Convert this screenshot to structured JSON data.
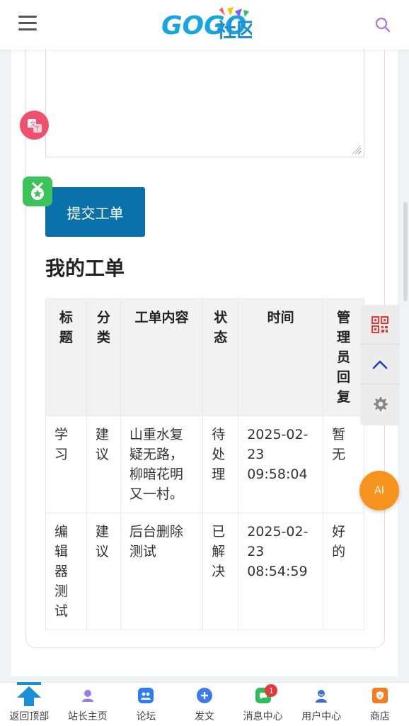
{
  "header": {
    "logo_text": "GOGO",
    "logo_sub": "社区"
  },
  "form": {
    "submit_label": "提交工单"
  },
  "section": {
    "title": "我的工单"
  },
  "table": {
    "headers": [
      "标题",
      "分类",
      "工单内容",
      "状态",
      "时间",
      "管理员回复"
    ],
    "rows": [
      {
        "title": "学习",
        "category": "建议",
        "content": "山重水复疑无路，柳暗花明又一村。",
        "status": "待处理",
        "time": "2025-02-23 09:58:04",
        "reply": "暂无"
      },
      {
        "title": "编辑器测试",
        "category": "建议",
        "content": "后台删除测试",
        "status": "已解决",
        "time": "2025-02-23 08:54:59",
        "reply": "好的"
      }
    ]
  },
  "floating": {
    "ai_label": "AI"
  },
  "bottom_nav": {
    "items": [
      {
        "label": "返回顶部",
        "icon": "arrow-up-icon"
      },
      {
        "label": "站长主页",
        "icon": "user-avatar-icon"
      },
      {
        "label": "论坛",
        "icon": "forum-icon"
      },
      {
        "label": "发文",
        "icon": "plus-icon"
      },
      {
        "label": "消息中心",
        "icon": "message-icon",
        "badge": "1"
      },
      {
        "label": "用户中心",
        "icon": "user-center-icon"
      },
      {
        "label": "商店",
        "icon": "shop-icon"
      }
    ]
  },
  "colors": {
    "primary": "#0b71ab",
    "brand": "#18a7e0",
    "ai": "#f7941d",
    "badge": "#e5383b"
  }
}
